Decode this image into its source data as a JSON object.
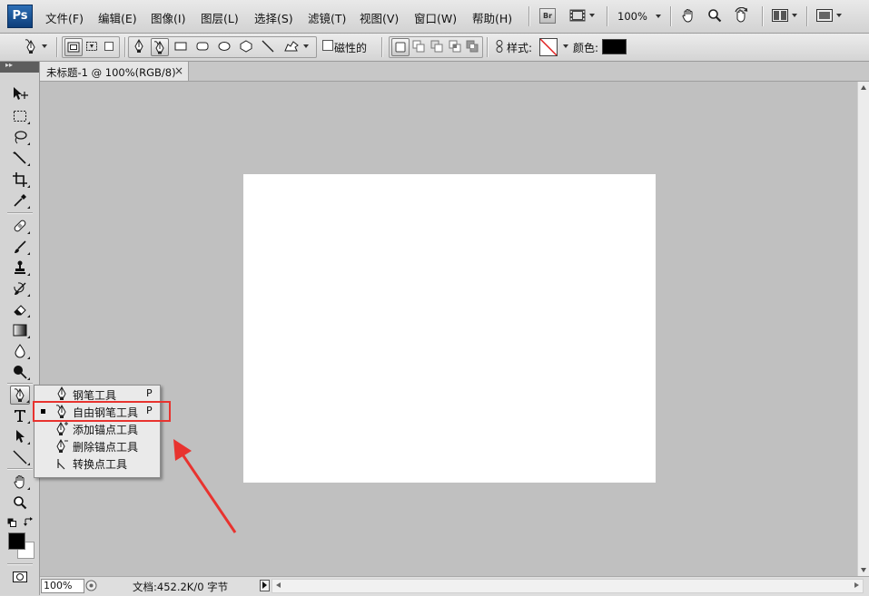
{
  "app": {
    "logo_text": "Ps"
  },
  "menu": [
    "文件(F)",
    "编辑(E)",
    "图像(I)",
    "图层(L)",
    "选择(S)",
    "滤镜(T)",
    "视图(V)",
    "窗口(W)",
    "帮助(H)"
  ],
  "app_bar": {
    "bridge_label": "Br",
    "zoom": "100%"
  },
  "options_bar": {
    "magnetic_label": "磁性的",
    "style_label": "样式:",
    "color_label": "颜色:",
    "color_value": "#000000"
  },
  "document": {
    "tab_title": "未标题-1 @ 100%(RGB/8)",
    "close_glyph": "×",
    "canvas_color": "#ffffff"
  },
  "status_bar": {
    "zoom": "100%",
    "doc_info": "文档:452.2K/0 字节"
  },
  "tool_flyout": {
    "items": [
      {
        "label": "钢笔工具",
        "shortcut": "P",
        "icon": "pen-icon"
      },
      {
        "label": "自由钢笔工具",
        "shortcut": "P",
        "icon": "freeform-pen-icon",
        "selected": true
      },
      {
        "label": "添加锚点工具",
        "shortcut": "",
        "icon": "add-anchor-point-icon"
      },
      {
        "label": "删除锚点工具",
        "shortcut": "",
        "icon": "delete-anchor-point-icon"
      },
      {
        "label": "转换点工具",
        "shortcut": "",
        "icon": "convert-point-icon"
      }
    ]
  },
  "annotation": {
    "color": "#e8332f"
  }
}
